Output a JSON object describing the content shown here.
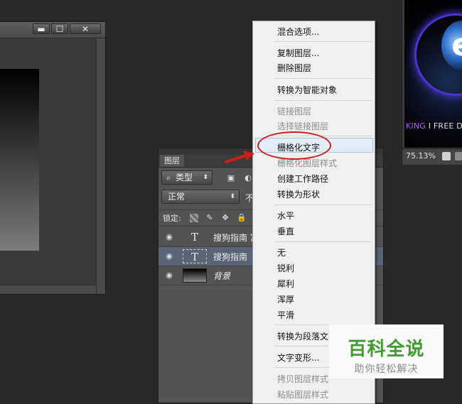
{
  "doc_window": {
    "minimize": "▬",
    "maximize": "☐",
    "close": "✕"
  },
  "right_window": {
    "logo_letter": "e",
    "tag_highlight": "KING",
    "tag_rest": " I FREE DR",
    "zoom": "75.13%"
  },
  "layers_panel": {
    "tab": "图层",
    "filter_label": "类型",
    "blend_mode": "正常",
    "opacity_label_partial": "不",
    "lock_label": "锁定:",
    "layers": [
      {
        "name": "搜狗指南 富",
        "kind": "text",
        "thumb": "T",
        "selected": false
      },
      {
        "name": "搜狗指南",
        "kind": "text",
        "thumb": "T",
        "selected": true
      },
      {
        "name": "背景",
        "kind": "background",
        "thumb": "",
        "selected": false
      }
    ]
  },
  "context_menu": {
    "items": [
      {
        "label": "混合选项...",
        "disabled": false
      },
      {
        "label": "复制图层...",
        "disabled": false
      },
      {
        "label": "删除图层",
        "disabled": false
      },
      {
        "label": "转换为智能对象",
        "disabled": false
      },
      {
        "label": "链接图层",
        "disabled": true
      },
      {
        "label": "选择链接图层",
        "disabled": true
      },
      {
        "label": "栅格化文字",
        "disabled": false
      },
      {
        "label": "栅格化图层样式",
        "disabled": true
      },
      {
        "label": "创建工作路径",
        "disabled": false
      },
      {
        "label": "转换为形状",
        "disabled": false
      },
      {
        "label": "水平",
        "disabled": false
      },
      {
        "label": "垂直",
        "disabled": false
      },
      {
        "label": "无",
        "disabled": false
      },
      {
        "label": "锐利",
        "disabled": false
      },
      {
        "label": "犀利",
        "disabled": false
      },
      {
        "label": "浑厚",
        "disabled": false
      },
      {
        "label": "平滑",
        "disabled": false
      },
      {
        "label": "转换为段落文",
        "disabled": false
      },
      {
        "label": "文字变形...",
        "disabled": false
      },
      {
        "label": "拷贝图层样式",
        "disabled": true
      },
      {
        "label": "粘贴图层样式",
        "disabled": true
      }
    ],
    "highlighted": "栅格化文字"
  },
  "watermark": {
    "title": "百科全说",
    "subtitle": "助你轻松解决"
  },
  "colors": {
    "app_bg": "#282828",
    "panel_bg": "#535353",
    "menu_bg": "#f0f0f0",
    "annotation_red": "#d01c1c",
    "watermark_green": "#3e9c2f"
  }
}
